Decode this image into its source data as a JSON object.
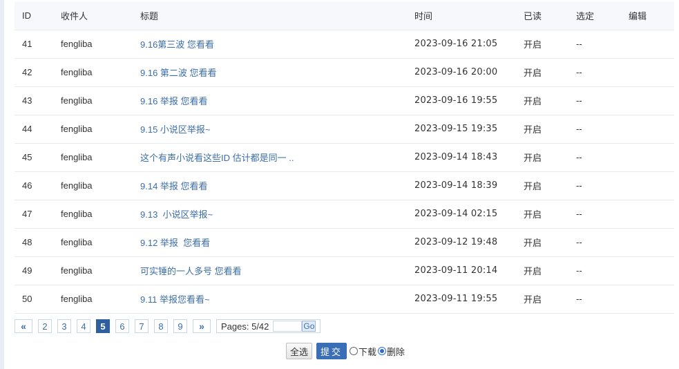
{
  "table": {
    "headers": {
      "id": "ID",
      "recipient": "收件人",
      "title": "标题",
      "time": "时间",
      "read": "已读",
      "select": "选定",
      "edit": "编辑"
    },
    "rows": [
      {
        "id": "41",
        "recipient": "fengliba",
        "title": "9.16第三波 您看看",
        "time": "2023-09-16 21:05",
        "read": "开启",
        "select": "--"
      },
      {
        "id": "42",
        "recipient": "fengliba",
        "title": "9.16 第二波 您看看",
        "time": "2023-09-16 20:00",
        "read": "开启",
        "select": "--"
      },
      {
        "id": "43",
        "recipient": "fengliba",
        "title": "9.16 举报 您看看",
        "time": "2023-09-16 19:55",
        "read": "开启",
        "select": "--"
      },
      {
        "id": "44",
        "recipient": "fengliba",
        "title": "9.15 小说区举报~",
        "time": "2023-09-15 19:35",
        "read": "开启",
        "select": "--"
      },
      {
        "id": "45",
        "recipient": "fengliba",
        "title": "这个有声小说看这些ID 估计都是同一 ..",
        "time": "2023-09-14 18:43",
        "read": "开启",
        "select": "--"
      },
      {
        "id": "46",
        "recipient": "fengliba",
        "title": "9.14 举报 您看看",
        "time": "2023-09-14 18:39",
        "read": "开启",
        "select": "--"
      },
      {
        "id": "47",
        "recipient": "fengliba",
        "title": "9.13  小说区举报~",
        "time": "2023-09-14 02:15",
        "read": "开启",
        "select": "--"
      },
      {
        "id": "48",
        "recipient": "fengliba",
        "title": "9.12 举报  您看看",
        "time": "2023-09-12 19:48",
        "read": "开启",
        "select": "--"
      },
      {
        "id": "49",
        "recipient": "fengliba",
        "title": "可实锤的一人多号 您看看",
        "time": "2023-09-11 20:14",
        "read": "开启",
        "select": "--"
      },
      {
        "id": "50",
        "recipient": "fengliba",
        "title": "9.11 举报您看看~",
        "time": "2023-09-11 19:55",
        "read": "开启",
        "select": "--"
      }
    ]
  },
  "pagination": {
    "prev_label": "«",
    "next_label": "»",
    "pages": [
      "2",
      "3",
      "4",
      "5",
      "6",
      "7",
      "8",
      "9"
    ],
    "current_page": "5",
    "pages_text": "Pages: 5/42",
    "page_input_value": "",
    "go_label": "Go"
  },
  "actions": {
    "select_all_label": "全选",
    "submit_label": "提交",
    "download_label": "下载",
    "delete_label": "删除",
    "selected_option": "删除"
  },
  "colors": {
    "link": "#3b6dab",
    "current_page_bg": "#2e5f9e",
    "submit_bg": "#3a6fb8"
  }
}
